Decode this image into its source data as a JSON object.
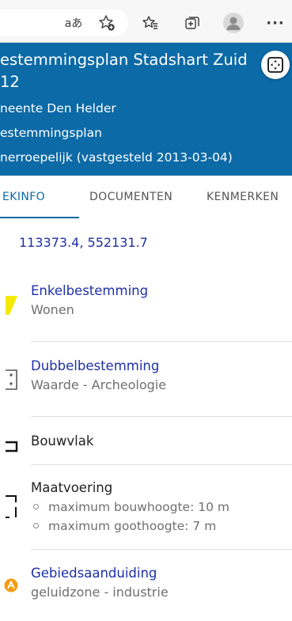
{
  "browser": {
    "read_aloud_label": "aあ",
    "add_favorite_icon": "star-plus-icon",
    "favorites_icon": "favorites-list-icon",
    "collections_icon": "collections-icon",
    "profile_icon": "profile-avatar-icon",
    "more_label": "···"
  },
  "header": {
    "title": "estemmingsplan Stadshart Zuid\n12",
    "municipality": "neente Den Helder",
    "type": "estemmingsplan",
    "status": "nerroepelijk (vastgesteld 2013-03-04)",
    "expand_icon": "expand-icon",
    "background_color": "#0c6aa6"
  },
  "tabs": [
    {
      "label": "EKINFO",
      "active": true
    },
    {
      "label": "DOCUMENTEN",
      "active": false
    },
    {
      "label": "KENMERKEN",
      "active": false
    }
  ],
  "coordinates": "113373.4, 552131.7",
  "items": [
    {
      "title": "Enkelbestemming",
      "subtitle": "Wonen",
      "icon": "yellow-parallelogram-icon",
      "color": "#f5ea00"
    },
    {
      "title": "Dubbelbestemming",
      "subtitle": "Waarde - Archeologie",
      "icon": "dotted-box-icon"
    },
    {
      "title": "Bouwvlak",
      "icon": "bracket-icon"
    },
    {
      "title": "Maatvoering",
      "icon": "dashed-bracket-icon",
      "bullets": [
        "maximum bouwhoogte: 10 m",
        "maximum goothoogte: 7 m"
      ]
    },
    {
      "title": "Gebiedsaanduiding",
      "subtitle": "geluidzone - industrie",
      "icon": "orange-badge-icon",
      "color": "#f39c12"
    }
  ]
}
